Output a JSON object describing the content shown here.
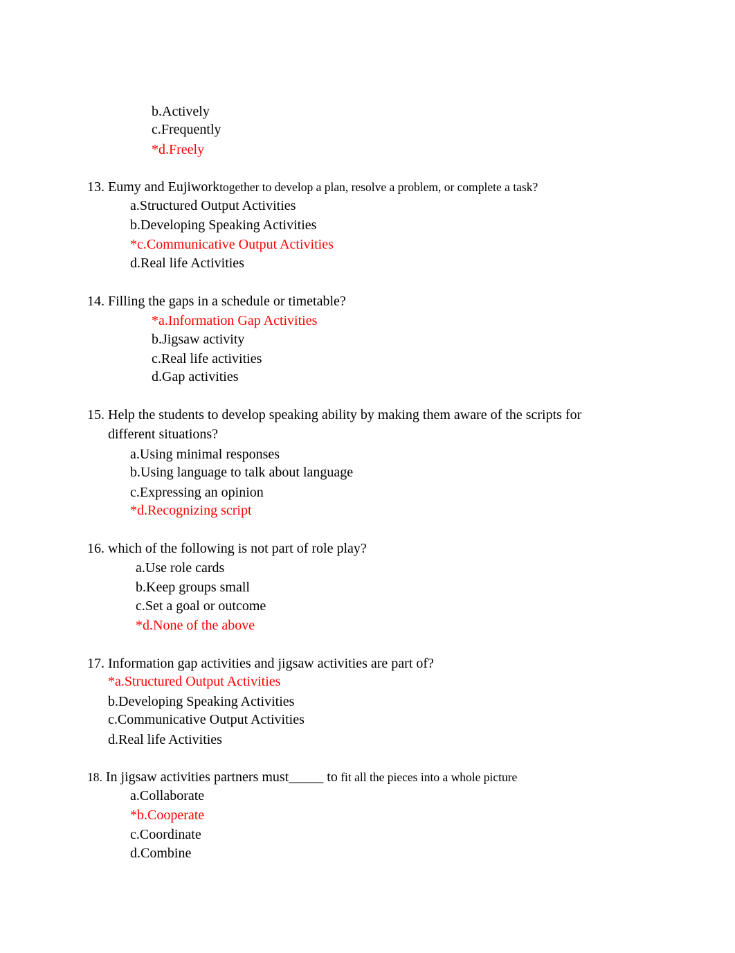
{
  "colors": {
    "text": "#000000",
    "answer": "#ff0000"
  },
  "q12_tail": {
    "options": [
      {
        "text": "b.Actively",
        "correct": false
      },
      {
        "text": "c.Frequently",
        "correct": false
      },
      {
        "text": "*d.Freely",
        "correct": true
      }
    ]
  },
  "q13": {
    "number": "13.",
    "lead": "Eumy and Eujiwork",
    "rest": "together to develop a plan, resolve a problem, or complete a task?",
    "options": [
      {
        "text": "a.Structured Output Activities",
        "correct": false
      },
      {
        "text": "b.Developing Speaking Activities",
        "correct": false
      },
      {
        "text": "*c.Communicative Output Activities",
        "correct": true
      },
      {
        "text": "d.Real life Activities",
        "correct": false
      }
    ]
  },
  "q14": {
    "text": "14. Filling the gaps in a schedule or timetable?",
    "options": [
      {
        "text": "*a.Information Gap Activities",
        "correct": true
      },
      {
        "text": "b.Jigsaw activity",
        "correct": false
      },
      {
        "text": "c.Real life activities",
        "correct": false
      },
      {
        "text": "d.Gap activities",
        "correct": false
      }
    ]
  },
  "q15": {
    "line1": "15. Help the students to develop speaking ability by making them aware of the scripts for",
    "line2": "different situations?",
    "options": [
      {
        "text": "a.Using minimal responses",
        "correct": false
      },
      {
        "text": "b.Using language to talk about language",
        "correct": false
      },
      {
        "text": "c.Expressing an opinion",
        "correct": false
      },
      {
        "text": "*d.Recognizing script",
        "correct": true
      }
    ]
  },
  "q16": {
    "text": "16. which of the following is not part of role play?",
    "options": [
      {
        "text": "a.Use role cards",
        "correct": false
      },
      {
        "text": "b.Keep groups small",
        "correct": false
      },
      {
        "text": "c.Set a goal or outcome",
        "correct": false
      },
      {
        "text": "*d.None of the above",
        "correct": true
      }
    ]
  },
  "q17": {
    "text": "17. Information gap activities and jigsaw activities are part of?",
    "options": [
      {
        "text": "*a.Structured Output Activities",
        "correct": true
      },
      {
        "text": "b.Developing Speaking Activities",
        "correct": false
      },
      {
        "text": "c.Communicative Output Activities",
        "correct": false
      },
      {
        "text": "d.Real life Activities",
        "correct": false
      }
    ]
  },
  "q18": {
    "number": "18.",
    "lead": "In jigsaw activities partners must_____ to",
    "rest": " fit all the pieces into a whole picture",
    "options": [
      {
        "text": "a.Collaborate",
        "correct": false
      },
      {
        "text": "*b.Cooperate",
        "correct": true
      },
      {
        "text": "c.Coordinate",
        "correct": false
      },
      {
        "text": "d.Combine",
        "correct": false
      }
    ]
  }
}
